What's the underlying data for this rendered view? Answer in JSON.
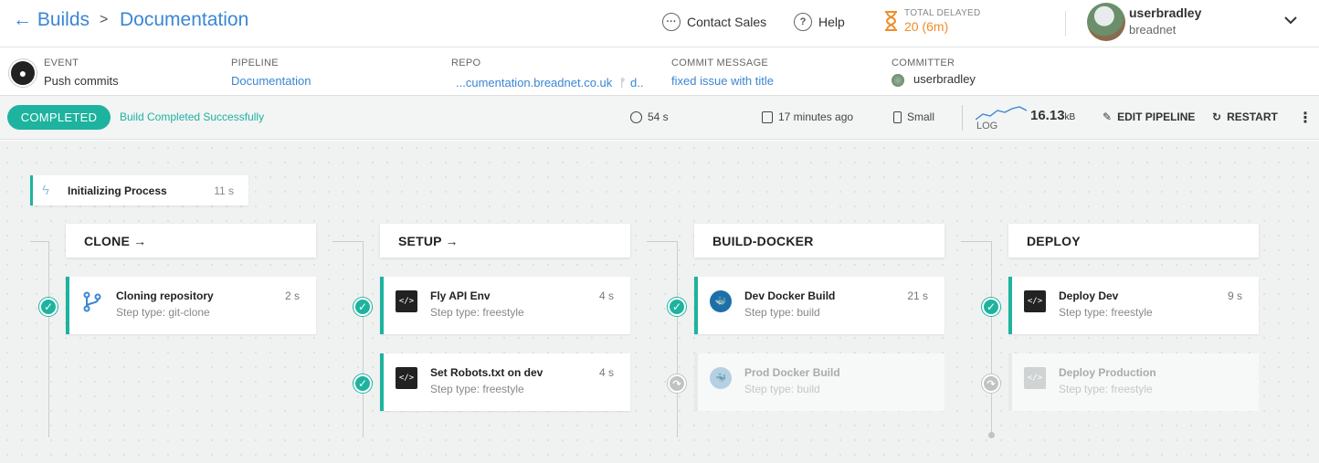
{
  "header": {
    "back_label": "← Builds",
    "separator": ">",
    "current": "Documentation",
    "contact_sales": "Contact Sales",
    "help": "Help",
    "total_delayed_label": "TOTAL DELAYED",
    "total_delayed_value": "20 (6m)",
    "user_name": "userbradley",
    "user_org": "breadnet"
  },
  "info": {
    "event_label": "EVENT",
    "event_value": "Push commits",
    "pipeline_label": "PIPELINE",
    "pipeline_value": "Documentation",
    "repo_label": "REPO",
    "repo_value": "...cumentation.breadnet.co.uk",
    "repo_branch": "d..",
    "commit_label": "COMMIT MESSAGE",
    "commit_value": "fixed issue with title",
    "committer_label": "COMMITTER",
    "committer_value": "userbradley"
  },
  "status": {
    "badge": "COMPLETED",
    "message": "Build Completed Successfully",
    "duration": "54 s",
    "when": "17 minutes ago",
    "size": "Small",
    "log_label": "LOG",
    "log_size": "16.13",
    "log_unit": "kB",
    "edit_pipeline": "EDIT PIPELINE",
    "restart": "RESTART"
  },
  "init": {
    "title": "Initializing Process",
    "time": "11 s"
  },
  "stages": [
    {
      "name": "CLONE →",
      "steps": [
        {
          "title": "Cloning repository",
          "type": "Step type: git-clone",
          "time": "2 s",
          "icon": "git-branch-icon",
          "done": true
        }
      ]
    },
    {
      "name": "SETUP →",
      "steps": [
        {
          "title": "Fly API Env",
          "type": "Step type: freestyle",
          "time": "4 s",
          "icon": "terminal-icon",
          "done": true
        },
        {
          "title": "Set Robots.txt on dev",
          "type": "Step type: freestyle",
          "time": "4 s",
          "icon": "terminal-icon",
          "done": true
        }
      ]
    },
    {
      "name": "BUILD-DOCKER",
      "steps": [
        {
          "title": "Dev Docker Build",
          "type": "Step type: build",
          "time": "21 s",
          "icon": "docker-icon",
          "done": true
        },
        {
          "title": "Prod Docker Build",
          "type": "Step type: build",
          "time": "",
          "icon": "docker-icon",
          "done": false
        }
      ]
    },
    {
      "name": "DEPLOY",
      "steps": [
        {
          "title": "Deploy Dev",
          "type": "Step type: freestyle",
          "time": "9 s",
          "icon": "terminal-icon",
          "done": true
        },
        {
          "title": "Deploy Production",
          "type": "Step type: freestyle",
          "time": "",
          "icon": "terminal-icon",
          "done": false
        }
      ]
    }
  ],
  "colors": {
    "accent": "#1db39f",
    "link": "#3a86d4",
    "delayed": "#f08c2b"
  }
}
